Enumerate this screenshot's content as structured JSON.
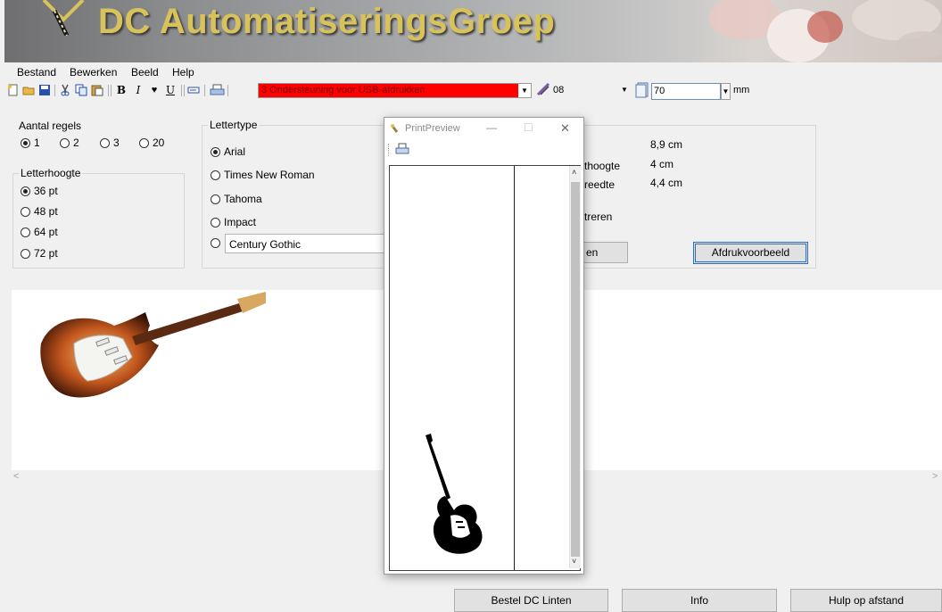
{
  "banner": {
    "title": "DC AutomatiseringsGroep"
  },
  "menu": {
    "items": [
      "Bestand",
      "Bewerken",
      "Beeld",
      "Help"
    ]
  },
  "toolbar": {
    "printer": "3 Ondersteuning voor USB-afdrukken",
    "tape": "08",
    "width_value": "70",
    "unit": "mm"
  },
  "lines_group": {
    "title": "Aantal regels",
    "options": [
      "1",
      "2",
      "3",
      "20"
    ],
    "selected": "1"
  },
  "height_group": {
    "title": "Letterhoogte",
    "options": [
      "36 pt",
      "48 pt",
      "64 pt",
      "72 pt"
    ],
    "selected": "36 pt"
  },
  "font_group": {
    "title": "Lettertype",
    "options": [
      "Arial",
      "Times New Roman",
      "Tahoma",
      "Impact"
    ],
    "selected": "Arial",
    "custom_value": "Century Gothic"
  },
  "info": {
    "row1_value": "8,9 cm",
    "row2_label_partial": "thoogte",
    "row2_value": "4 cm",
    "row3_label_partial": "reedte",
    "row3_value": "4,4 cm",
    "row4_label_partial": "treren",
    "hidden_button_partial": "en",
    "preview_button": "Afdrukvoorbeeld"
  },
  "bottom_buttons": {
    "order": "Bestel DC Linten",
    "info": "Info",
    "help": "Hulp op afstand"
  },
  "print_preview": {
    "title": "PrintPreview",
    "minimize": "—",
    "maximize": "☐",
    "close": "✕"
  },
  "colors": {
    "printer_highlight": "#ff0000",
    "banner_text": "#d8c25c",
    "accent_border": "#2c6fbf"
  },
  "icons": [
    "new-icon",
    "open-icon",
    "save-icon",
    "cut-icon",
    "copy-icon",
    "paste-icon",
    "bold-icon",
    "italic-icon",
    "heart-icon",
    "underline-icon",
    "text-icon",
    "printer-icon",
    "tape-icon",
    "page-icon",
    "guitar-icon"
  ]
}
